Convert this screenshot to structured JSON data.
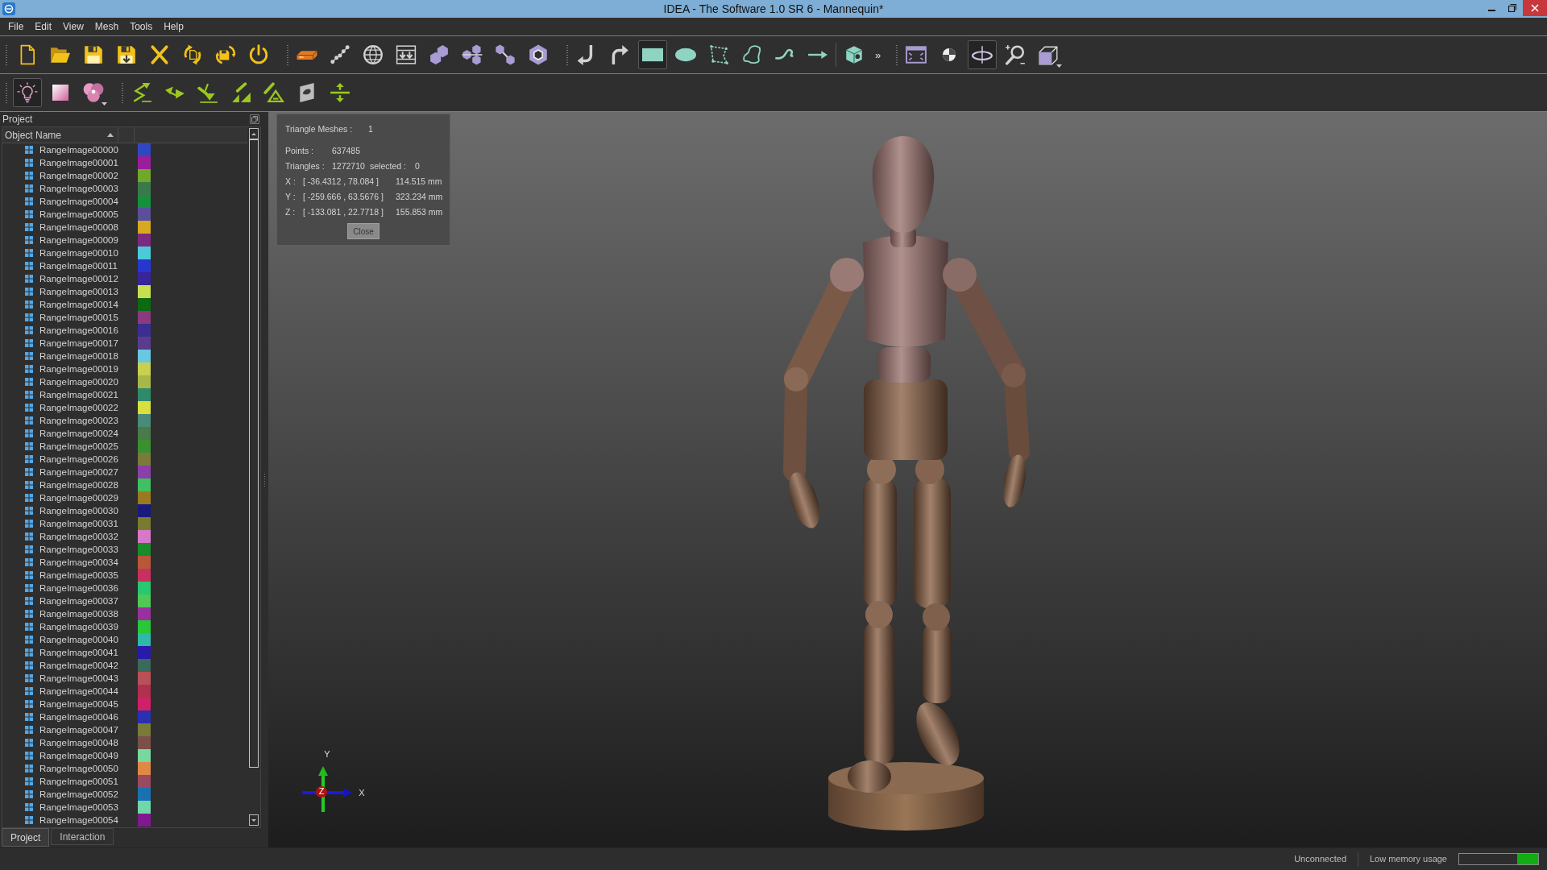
{
  "window": {
    "title": "IDEA - The Software 1.0 SR 6 - Mannequin*"
  },
  "menu": [
    "File",
    "Edit",
    "View",
    "Mesh",
    "Tools",
    "Help"
  ],
  "toolbars": [
    {
      "sections": [
        {
          "kind": "grip",
          "buttons": [
            {
              "active": false
            },
            {
              "active": false
            },
            {
              "active": false
            },
            {
              "active": false
            },
            {
              "active": false
            },
            {
              "active": false
            },
            {
              "active": false
            },
            {
              "active": false
            }
          ]
        },
        {
          "kind": "grip",
          "buttons": [
            {
              "active": false
            },
            {
              "active": false
            },
            {
              "active": false
            },
            {
              "active": false
            },
            {
              "active": false
            },
            {
              "active": false
            },
            {
              "active": false
            },
            {
              "active": false
            }
          ]
        },
        {
          "kind": "grip",
          "buttons": [
            {
              "active": false
            },
            {
              "active": false
            },
            {
              "active": true
            },
            {
              "active": false
            },
            {
              "active": false
            },
            {
              "active": false
            },
            {
              "active": false
            },
            {
              "active": false
            }
          ]
        },
        {
          "kind": "line",
          "buttons": [
            {
              "active": false
            }
          ],
          "overflow": "»"
        },
        {
          "kind": "grip",
          "buttons": [
            {
              "active": false
            },
            {
              "active": false
            },
            {
              "active": true
            },
            {
              "active": false
            },
            {
              "active": false
            }
          ]
        }
      ]
    },
    {
      "sections": [
        {
          "kind": "grip",
          "buttons": [
            {
              "active": true
            },
            {
              "active": false
            },
            {
              "active": false
            }
          ]
        },
        {
          "kind": "grip",
          "buttons": [
            {
              "active": false
            },
            {
              "active": false
            },
            {
              "active": false
            },
            {
              "active": false
            },
            {
              "active": false
            },
            {
              "active": false
            },
            {
              "active": false
            }
          ]
        }
      ]
    }
  ],
  "project_panel": {
    "title": "Project",
    "columns": [
      {
        "label": "Object Name",
        "sort_ascending": true
      }
    ],
    "objects": [
      {
        "name": "RangeImage00000",
        "color": "#2f47c0"
      },
      {
        "name": "RangeImage00001",
        "color": "#9a1e9a"
      },
      {
        "name": "RangeImage00002",
        "color": "#70a82a"
      },
      {
        "name": "RangeImage00003",
        "color": "#3a7a4a"
      },
      {
        "name": "RangeImage00004",
        "color": "#16903c"
      },
      {
        "name": "RangeImage00005",
        "color": "#5a4f9a"
      },
      {
        "name": "RangeImage00008",
        "color": "#d8a820"
      },
      {
        "name": "RangeImage00009",
        "color": "#7a2a80"
      },
      {
        "name": "RangeImage00010",
        "color": "#4ccad8"
      },
      {
        "name": "RangeImage00011",
        "color": "#2836d0"
      },
      {
        "name": "RangeImage00012",
        "color": "#3a249a"
      },
      {
        "name": "RangeImage00013",
        "color": "#c8e050"
      },
      {
        "name": "RangeImage00014",
        "color": "#0c6a10"
      },
      {
        "name": "RangeImage00015",
        "color": "#8a3a80"
      },
      {
        "name": "RangeImage00016",
        "color": "#3a2e90"
      },
      {
        "name": "RangeImage00017",
        "color": "#5a3c8e"
      },
      {
        "name": "RangeImage00018",
        "color": "#68c8e0"
      },
      {
        "name": "RangeImage00019",
        "color": "#c8d050"
      },
      {
        "name": "RangeImage00020",
        "color": "#a8b848"
      },
      {
        "name": "RangeImage00021",
        "color": "#2e8a6a"
      },
      {
        "name": "RangeImage00022",
        "color": "#d8e040"
      },
      {
        "name": "RangeImage00023",
        "color": "#4a8a7a"
      },
      {
        "name": "RangeImage00024",
        "color": "#4a7a4a"
      },
      {
        "name": "RangeImage00025",
        "color": "#3a9030"
      },
      {
        "name": "RangeImage00026",
        "color": "#7a7a3a"
      },
      {
        "name": "RangeImage00027",
        "color": "#8a40a8"
      },
      {
        "name": "RangeImage00028",
        "color": "#40c060"
      },
      {
        "name": "RangeImage00029",
        "color": "#9a7a20"
      },
      {
        "name": "RangeImage00030",
        "color": "#1a1a7a"
      },
      {
        "name": "RangeImage00031",
        "color": "#7a7a30"
      },
      {
        "name": "RangeImage00032",
        "color": "#d878c8"
      },
      {
        "name": "RangeImage00033",
        "color": "#1a8a2a"
      },
      {
        "name": "RangeImage00034",
        "color": "#b85838"
      },
      {
        "name": "RangeImage00035",
        "color": "#c83060"
      },
      {
        "name": "RangeImage00036",
        "color": "#28c870"
      },
      {
        "name": "RangeImage00037",
        "color": "#50c858"
      },
      {
        "name": "RangeImage00038",
        "color": "#9a30a0"
      },
      {
        "name": "RangeImage00039",
        "color": "#28c838"
      },
      {
        "name": "RangeImage00040",
        "color": "#30b8a8"
      },
      {
        "name": "RangeImage00041",
        "color": "#2a1aa8"
      },
      {
        "name": "RangeImage00042",
        "color": "#3a6a5a"
      },
      {
        "name": "RangeImage00043",
        "color": "#b85058"
      },
      {
        "name": "RangeImage00044",
        "color": "#b03050"
      },
      {
        "name": "RangeImage00045",
        "color": "#d02068"
      },
      {
        "name": "RangeImage00046",
        "color": "#2a30b0"
      },
      {
        "name": "RangeImage00047",
        "color": "#7a7a38"
      },
      {
        "name": "RangeImage00048",
        "color": "#7a5048"
      },
      {
        "name": "RangeImage00049",
        "color": "#78d8a0"
      },
      {
        "name": "RangeImage00050",
        "color": "#e08848"
      },
      {
        "name": "RangeImage00051",
        "color": "#9a4a60"
      },
      {
        "name": "RangeImage00052",
        "color": "#1a70b0"
      },
      {
        "name": "RangeImage00053",
        "color": "#70d8a8"
      },
      {
        "name": "RangeImage00054",
        "color": "#801890"
      }
    ]
  },
  "panel_tabs": [
    {
      "label": "Project",
      "selected": true
    },
    {
      "label": "Interaction",
      "selected": false
    }
  ],
  "viewport": {
    "info_panel": {
      "meshes": {
        "label": "Triangle Meshes :",
        "value": "1"
      },
      "points": {
        "label": "Points :",
        "value": "637485"
      },
      "triangles": {
        "label": "Triangles :",
        "value": "1272710",
        "selected_label": "selected :",
        "selected_value": "0"
      },
      "extents": [
        {
          "axis": "X :",
          "range": "[ -36.4312 , 78.084 ]",
          "length": "114.515 mm"
        },
        {
          "axis": "Y :",
          "range": "[ -259.666 , 63.5676 ]",
          "length": "323.234 mm"
        },
        {
          "axis": "Z :",
          "range": "[ -133.081 , 22.7718 ]",
          "length": "155.853 mm"
        }
      ],
      "close_button": "Close"
    },
    "axes": {
      "x": "X",
      "y": "Y",
      "z": "Z"
    }
  },
  "status_bar": {
    "connection": "Unconnected",
    "memory": {
      "label": "Low memory usage",
      "level": 0.27
    }
  }
}
